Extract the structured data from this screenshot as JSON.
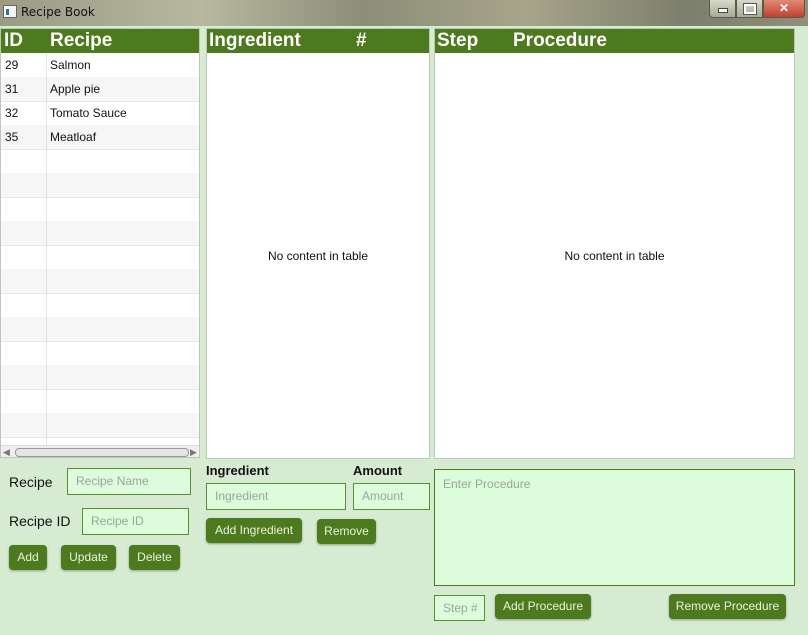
{
  "window": {
    "title": "Recipe Book"
  },
  "recipes_table": {
    "headers": {
      "id": "ID",
      "recipe": "Recipe"
    },
    "rows": [
      {
        "id": "29",
        "name": "Salmon"
      },
      {
        "id": "31",
        "name": "Apple pie"
      },
      {
        "id": "32",
        "name": "Tomato Sauce"
      },
      {
        "id": "35",
        "name": "Meatloaf"
      }
    ]
  },
  "ingredients_table": {
    "headers": {
      "ingredient": "Ingredient",
      "amount": "#"
    },
    "empty_text": "No content in table"
  },
  "procedure_table": {
    "headers": {
      "step": "Step",
      "procedure": "Procedure"
    },
    "empty_text": "No content in table"
  },
  "recipe_form": {
    "recipe_label": "Recipe",
    "recipe_placeholder": "Recipe Name",
    "id_label": "Recipe ID",
    "id_placeholder": "Recipe ID",
    "add_label": "Add",
    "update_label": "Update",
    "delete_label": "Delete"
  },
  "ingredient_form": {
    "ingredient_label": "Ingredient",
    "amount_label": "Amount",
    "ingredient_placeholder": "Ingredient",
    "amount_placeholder": "Amount",
    "add_label": "Add Ingredient",
    "remove_label": "Remove"
  },
  "procedure_form": {
    "procedure_placeholder": "Enter Procedure",
    "step_placeholder": "Step #",
    "add_label": "Add Procedure",
    "remove_label": "Remove Procedure"
  },
  "colors": {
    "accent": "#4c7a1c",
    "background": "#d6ebd2",
    "field": "#dcfcdc"
  }
}
